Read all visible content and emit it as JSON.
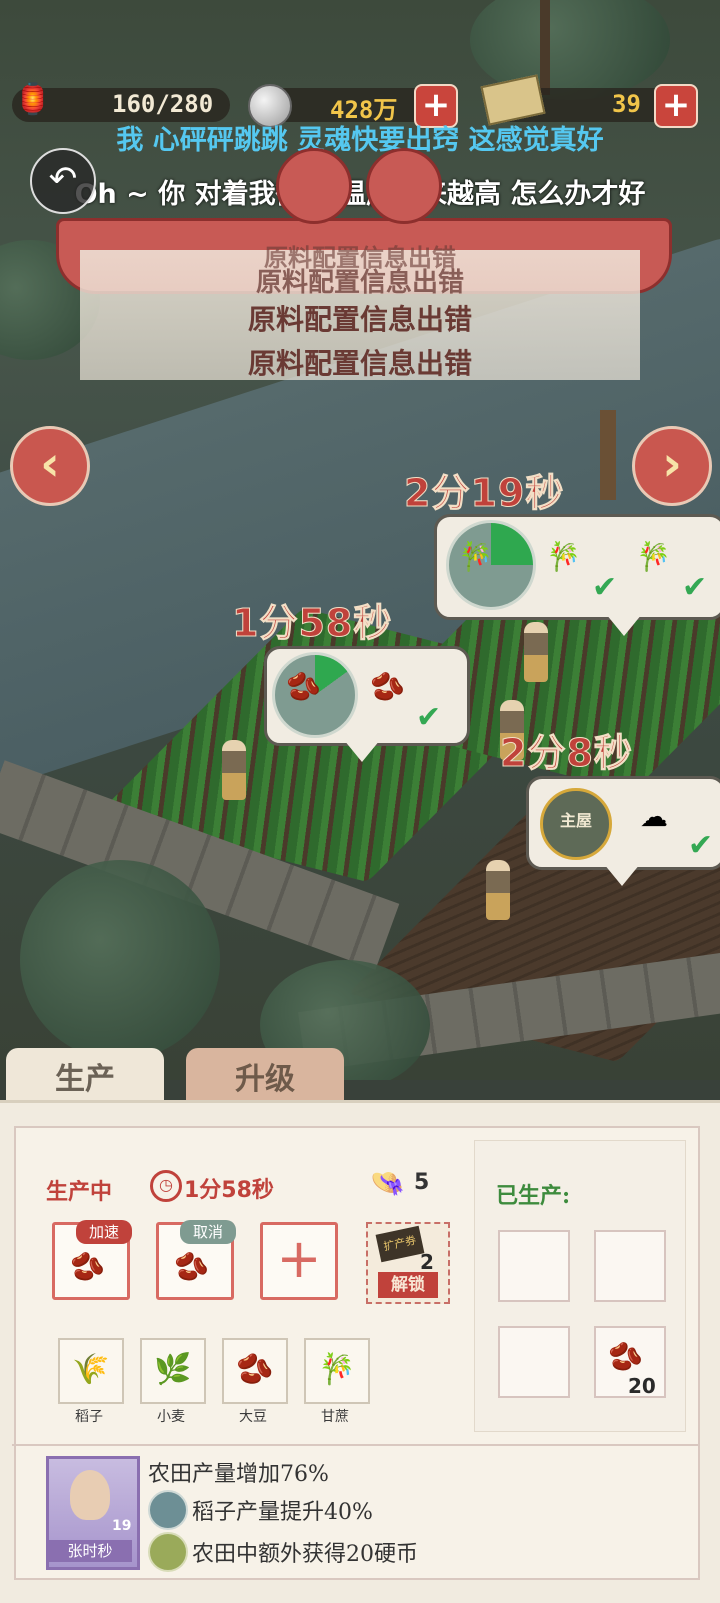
{
  "hud": {
    "stamina": "160/280",
    "coins": "428万",
    "cash": "39"
  },
  "lyrics": {
    "line1": "我 心砰砰跳跳 灵魂快要出窍 这感觉真好",
    "line2": "Oh ~ 你 对着我微笑 温度越来越高 怎么办才好"
  },
  "banner": {
    "error_lines": [
      "原料配置信息出错",
      "原料配置信息出错",
      "原料配置信息出错",
      "原料配置信息出错"
    ]
  },
  "fields": [
    {
      "timer": "2分19秒",
      "progress": 0.25,
      "done_count": 2
    },
    {
      "timer": "1分58秒",
      "progress": 0.15,
      "done_count": 1
    },
    {
      "timer": "2分8秒",
      "tag": "主屋"
    }
  ],
  "tabs": {
    "produce": "生产",
    "upgrade": "升级"
  },
  "production": {
    "status_label": "生产中",
    "time_left": "1分58秒",
    "worker_count": "5",
    "speedup_label": "加速",
    "cancel_label": "取消",
    "coupon_label": "扩产券",
    "coupon_count": "2",
    "unlock_label": "解锁",
    "produced_title": "已生产:",
    "produced_count": "20"
  },
  "seeds": [
    {
      "label": "稻子",
      "icon": "rice-icon"
    },
    {
      "label": "小麦",
      "icon": "wheat-icon"
    },
    {
      "label": "大豆",
      "icon": "soybean-icon"
    },
    {
      "label": "甘蔗",
      "icon": "sugarcane-icon"
    }
  ],
  "worker": {
    "name": "张时秒",
    "level": "19",
    "bonuses": [
      "农田产量增加76%",
      "稻子产量提升40%",
      "农田中额外获得20硬币"
    ]
  },
  "colors": {
    "accent_red": "#c9453c",
    "produce_green": "#3d8b3d",
    "panel_bg": "#f1ebe0"
  }
}
